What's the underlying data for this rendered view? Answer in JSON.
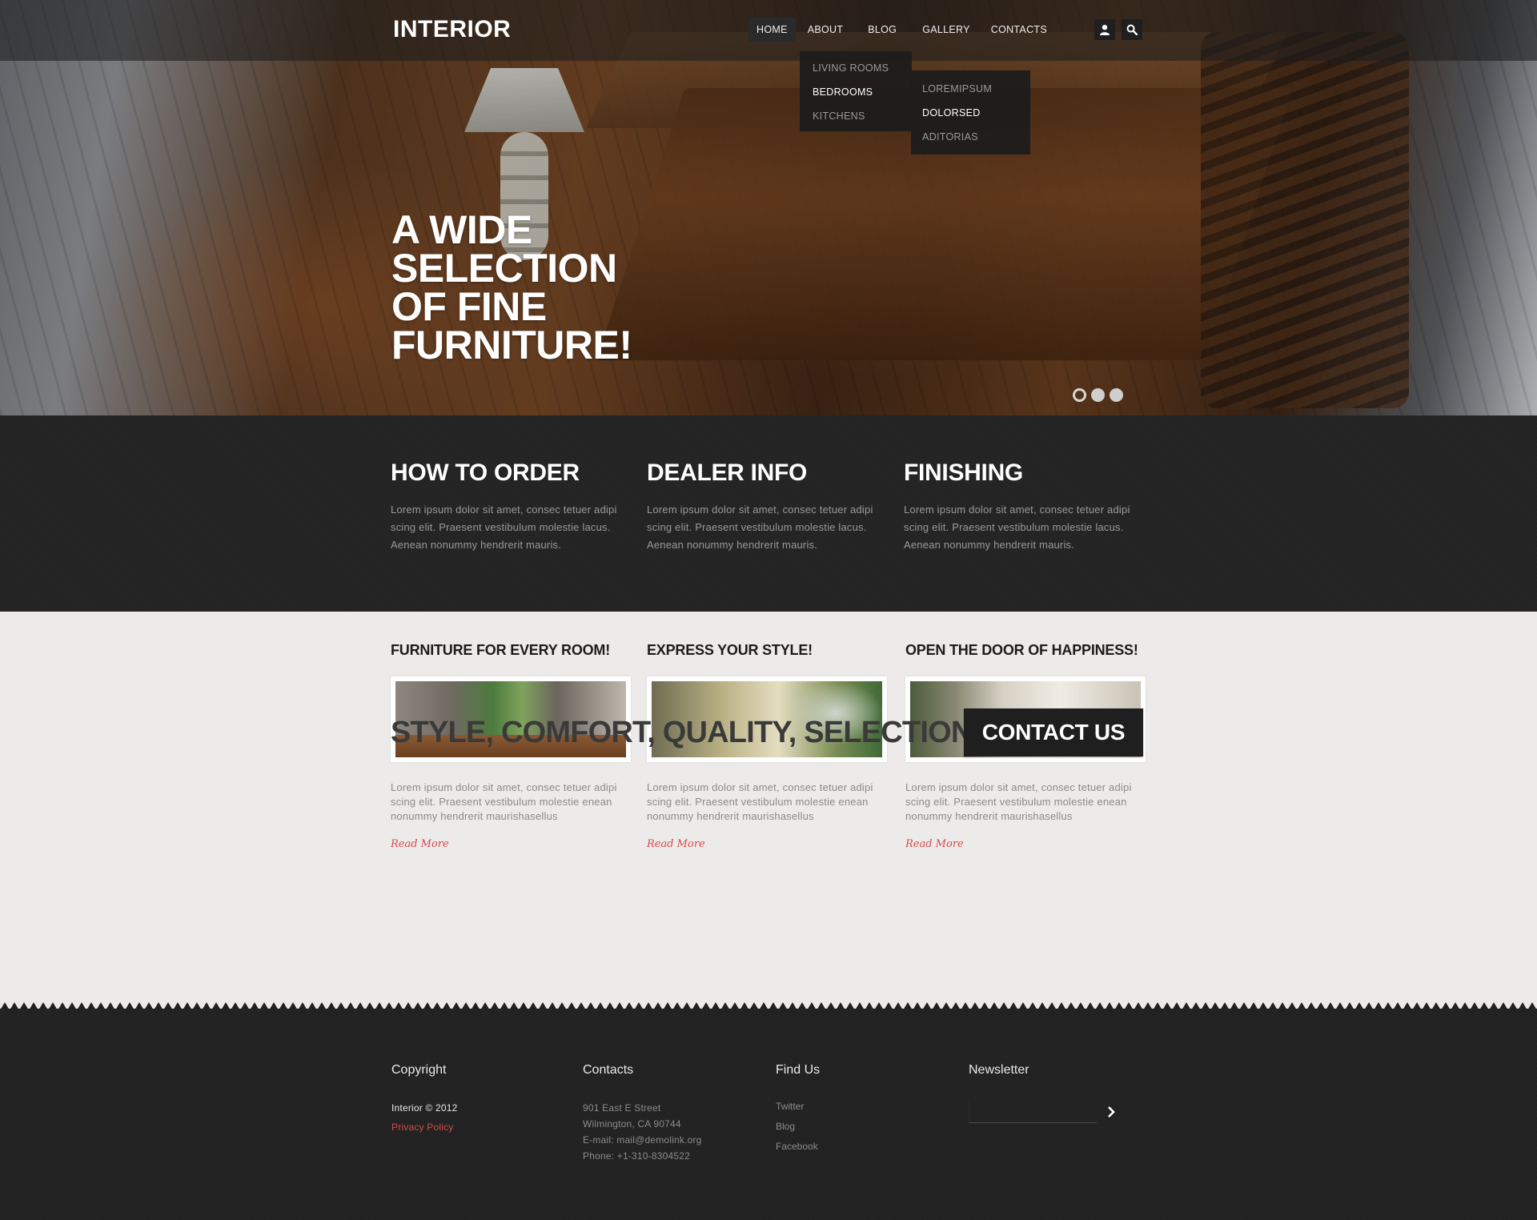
{
  "header": {
    "logo": "INTERIOR",
    "nav": [
      "HOME",
      "ABOUT",
      "BLOG",
      "GALLERY",
      "CONTACTS"
    ],
    "active_nav": "HOME",
    "icons": [
      "user-icon",
      "search-icon"
    ]
  },
  "dropdown_about": {
    "items": [
      "LIVING ROOMS",
      "BEDROOMS",
      "KITCHENS"
    ],
    "highlighted": "BEDROOMS"
  },
  "dropdown_bedrooms": {
    "items": [
      "LOREMIPSUM",
      "DOLORSED",
      "ADITORIAS"
    ],
    "highlighted": "DOLORSED"
  },
  "hero": {
    "title_lines": [
      "A WIDE",
      "SELECTION",
      "OF FINE",
      "FURNITURE!"
    ],
    "slider_dots": 3,
    "active_dot": 1
  },
  "info": [
    {
      "title": "HOW TO ORDER",
      "text": "Lorem ipsum dolor sit amet, consec tetuer adipi scing elit. Praesent vestibulum molestie lacus. Aenean nonummy hendrerit mauris."
    },
    {
      "title": "DEALER INFO",
      "text": "Lorem ipsum dolor sit amet, consec tetuer adipi scing elit. Praesent vestibulum molestie lacus. Aenean nonummy hendrerit mauris."
    },
    {
      "title": "FINISHING",
      "text": "Lorem ipsum dolor sit amet, consec tetuer adipi scing elit. Praesent vestibulum molestie lacus. Aenean nonummy hendrerit mauris."
    }
  ],
  "features": [
    {
      "title": "FURNITURE FOR EVERY ROOM!",
      "text": "Lorem ipsum dolor sit amet, consec tetuer adipi scing elit. Praesent vestibulum molestie enean nonummy hendrerit maurishasellus",
      "link": "Read More"
    },
    {
      "title": "EXPRESS YOUR STYLE!",
      "text": "Lorem ipsum dolor sit amet, consec tetuer adipi scing elit. Praesent vestibulum molestie enean nonummy hendrerit maurishasellus",
      "link": "Read More"
    },
    {
      "title": "OPEN THE DOOR OF HAPPINESS!",
      "text": "Lorem ipsum dolor sit amet, consec tetuer adipi scing elit. Praesent vestibulum molestie enean nonummy hendrerit maurishasellus",
      "link": "Read More"
    }
  ],
  "cta": {
    "tagline": "STYLE, COMFORT, QUALITY, SELECTION!",
    "button": "CONTACT US"
  },
  "footer": {
    "copyright": {
      "heading": "Copyright",
      "line": "Interior © 2012",
      "link": "Privacy Policy"
    },
    "contacts": {
      "heading": "Contacts",
      "lines": [
        "901 East E Street",
        "Wilmington, CA 90744",
        "E-mail: mail@demolink.org",
        "Phone: +1-310-8304522"
      ]
    },
    "find_us": {
      "heading": "Find Us",
      "links": [
        "Twitter",
        "Blog",
        "Facebook"
      ]
    },
    "newsletter": {
      "heading": "Newsletter",
      "value": "",
      "placeholder": ""
    }
  },
  "colors": {
    "accent": "#d44a4a",
    "dark": "#232323",
    "light_bg": "#ecebe9"
  }
}
